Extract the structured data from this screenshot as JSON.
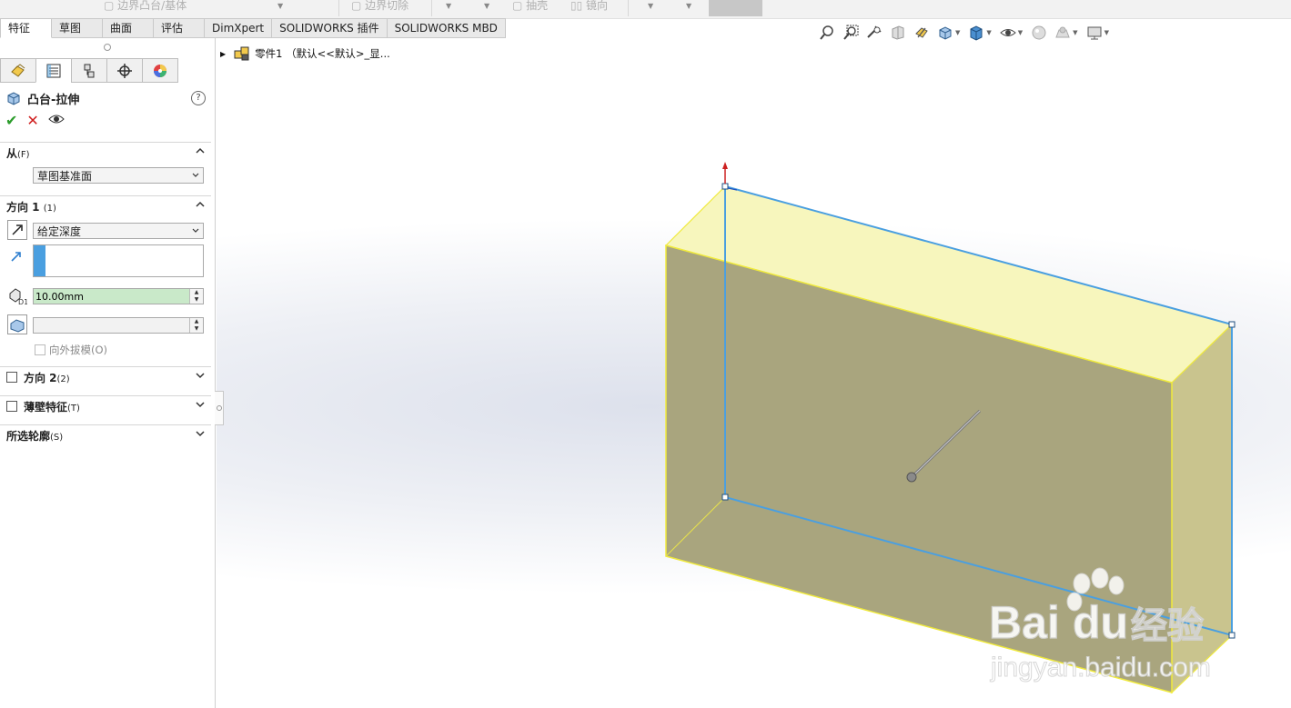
{
  "top_toolbar": {
    "items": [
      "边界凸台/基体",
      "边界切除",
      "抽壳",
      "镜向"
    ]
  },
  "command_tabs": [
    "特征",
    "草图",
    "曲面",
    "评估",
    "DimXpert",
    "SOLIDWORKS 插件",
    "SOLIDWORKS MBD"
  ],
  "command_tabs_active": "特征",
  "property_manager": {
    "tabs": [
      "feature-manager-icon",
      "property-manager-icon",
      "configuration-manager-icon",
      "dimxpert-manager-icon",
      "display-manager-icon"
    ],
    "title": "凸台-拉伸",
    "help": "?",
    "from": {
      "label": "从",
      "shortcut": "(F)",
      "value": "草图基准面"
    },
    "direction1": {
      "label": "方向 1",
      "shortcut": "(1)",
      "end_condition": "给定深度",
      "depth_value": "10.00mm",
      "draft_value": "",
      "draft_outward_label": "向外拔模(O)"
    },
    "direction2": {
      "label": "方向 2",
      "shortcut": "(2)"
    },
    "thin_feature": {
      "label": "薄壁特征",
      "shortcut": "(T)"
    },
    "selected_contours": {
      "label": "所选轮廓",
      "shortcut": "(S)"
    }
  },
  "feature_tree": {
    "root_label": "零件1 （默认<<默认>_显..."
  },
  "colors": {
    "accent_blue": "#4a9fe0",
    "preview_yellow": "#f4f27a",
    "selected_green": "#c9e9c9"
  },
  "watermark": {
    "brand": "Baidu 经验",
    "url": "jingyan.baidu.com"
  }
}
